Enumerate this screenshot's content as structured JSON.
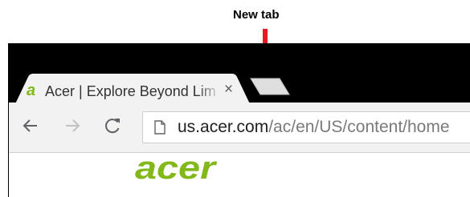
{
  "annotation": {
    "label": "New tab"
  },
  "tab": {
    "favicon_letter": "a",
    "title": "Acer | Explore Beyond Limits",
    "close_glyph": "×"
  },
  "toolbar": {
    "url_host": "us.acer.com",
    "url_path": "/ac/en/US/content/home"
  },
  "content": {
    "logo_text": "acer"
  },
  "colors": {
    "brand_green": "#83b81a",
    "annotation_arrow": "#e8191f",
    "tabstrip": "#000000",
    "toolbar": "#f2f2f2"
  },
  "icons": [
    "back-arrow-icon",
    "forward-arrow-icon",
    "reload-icon",
    "page-icon",
    "close-icon",
    "arrow-down-icon"
  ]
}
